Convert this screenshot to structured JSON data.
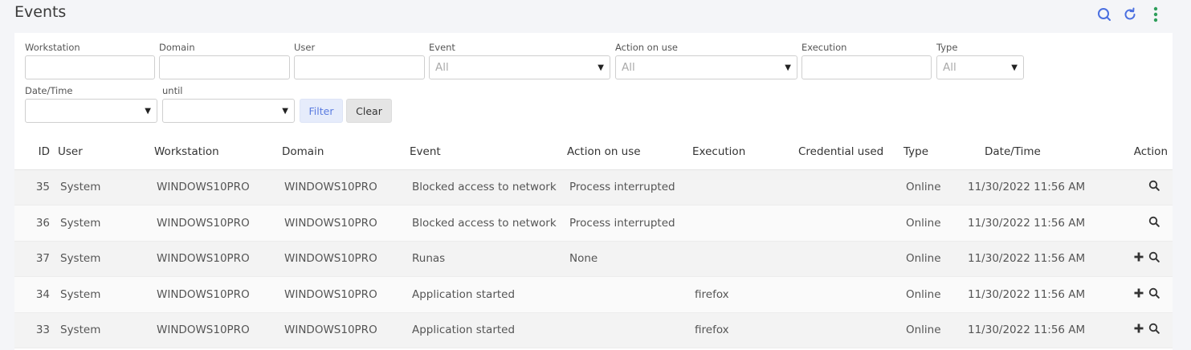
{
  "page": {
    "title": "Events"
  },
  "toolbar": {
    "icons": [
      "search-icon",
      "refresh-icon",
      "more-vertical-icon"
    ],
    "accent": "#4a6fe0",
    "more_color": "#2e9e5b"
  },
  "filters": {
    "workstation": {
      "label": "Workstation",
      "value": ""
    },
    "domain": {
      "label": "Domain",
      "value": ""
    },
    "user": {
      "label": "User",
      "value": ""
    },
    "event": {
      "label": "Event",
      "value": "All"
    },
    "action_on_use": {
      "label": "Action on use",
      "value": "All"
    },
    "execution": {
      "label": "Execution",
      "value": ""
    },
    "type": {
      "label": "Type",
      "value": "All"
    },
    "datetime": {
      "label": "Date/Time",
      "value": ""
    },
    "until": {
      "label": "until",
      "value": ""
    },
    "filter_button": "Filter",
    "clear_button": "Clear"
  },
  "table": {
    "columns": [
      "ID",
      "User",
      "Workstation",
      "Domain",
      "Event",
      "Action on use",
      "Execution",
      "Credential used",
      "Type",
      "Date/Time",
      "Action"
    ],
    "rows": [
      {
        "id": "35",
        "user": "System",
        "workstation": "WINDOWS10PRO",
        "domain": "WINDOWS10PRO",
        "event": "Blocked access to network",
        "action_on_use": "Process interrupted",
        "execution": "",
        "credential": "",
        "type": "Online",
        "datetime": "11/30/2022 11:56 AM",
        "actions": [
          "search-icon"
        ]
      },
      {
        "id": "36",
        "user": "System",
        "workstation": "WINDOWS10PRO",
        "domain": "WINDOWS10PRO",
        "event": "Blocked access to network",
        "action_on_use": "Process interrupted",
        "execution": "",
        "credential": "",
        "type": "Online",
        "datetime": "11/30/2022 11:56 AM",
        "actions": [
          "search-icon"
        ]
      },
      {
        "id": "37",
        "user": "System",
        "workstation": "WINDOWS10PRO",
        "domain": "WINDOWS10PRO",
        "event": "Runas",
        "action_on_use": "None",
        "execution": "",
        "credential": "",
        "type": "Online",
        "datetime": "11/30/2022 11:56 AM",
        "actions": [
          "plus-icon",
          "search-icon"
        ]
      },
      {
        "id": "34",
        "user": "System",
        "workstation": "WINDOWS10PRO",
        "domain": "WINDOWS10PRO",
        "event": "Application started",
        "action_on_use": "",
        "execution": "firefox",
        "credential": "",
        "type": "Online",
        "datetime": "11/30/2022 11:56 AM",
        "actions": [
          "plus-icon",
          "search-icon"
        ]
      },
      {
        "id": "33",
        "user": "System",
        "workstation": "WINDOWS10PRO",
        "domain": "WINDOWS10PRO",
        "event": "Application started",
        "action_on_use": "",
        "execution": "firefox",
        "credential": "",
        "type": "Online",
        "datetime": "11/30/2022 11:56 AM",
        "actions": [
          "plus-icon",
          "search-icon"
        ]
      }
    ]
  }
}
